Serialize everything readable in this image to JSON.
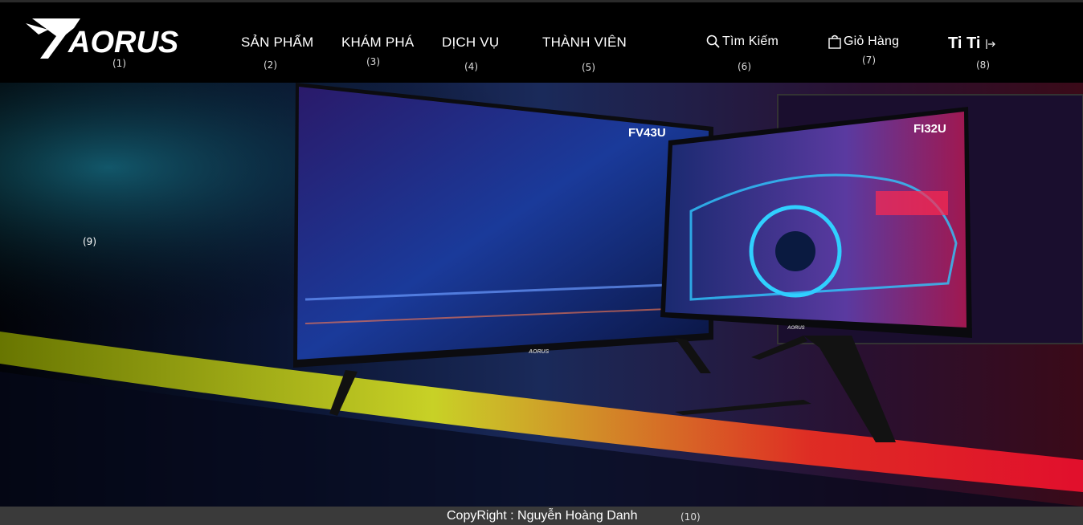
{
  "header": {
    "brand": "AORUS",
    "nav": {
      "products": "SẢN PHẨM",
      "explore": "KHÁM PHÁ",
      "services": "DỊCH VỤ",
      "members": "THÀNH VIÊN",
      "search": "Tìm Kiếm",
      "cart": "Giỏ Hàng",
      "user": "Ti Ti"
    },
    "markers": [
      "(1)",
      "(2)",
      "(3)",
      "(4)",
      "(5)",
      "(6)",
      "(7)",
      "(8)"
    ]
  },
  "hero": {
    "marker": "(9)",
    "monitor_left_model": "FV43U",
    "monitor_right_model": "FI32U",
    "monitor_brand": "AORUS"
  },
  "footer": {
    "copyright": "CopyRight : Nguyễn Hoàng Danh",
    "marker": "(10)"
  }
}
